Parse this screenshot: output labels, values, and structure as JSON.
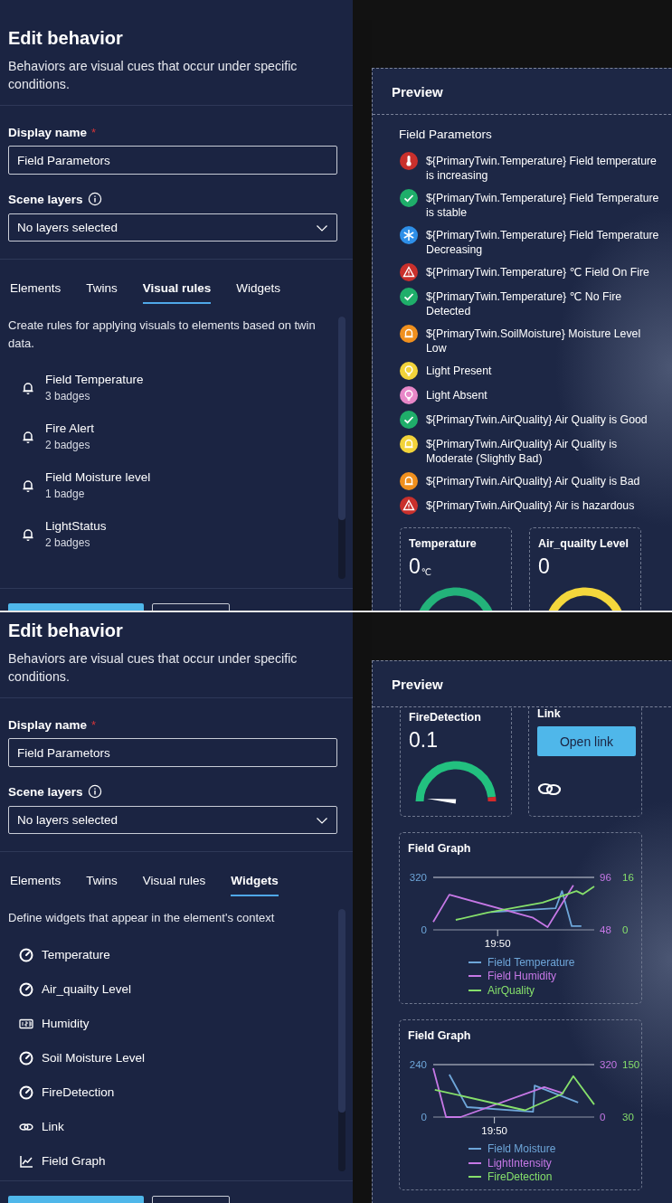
{
  "screens": [
    {
      "editor": {
        "title": "Edit behavior",
        "description": "Behaviors are visual cues that occur under specific conditions.",
        "display_name": {
          "label": "Display name",
          "required_mark": "*",
          "value": "Field Parametors"
        },
        "scene_layers": {
          "label": "Scene layers",
          "value": "No layers selected"
        },
        "tabs": [
          {
            "label": "Elements",
            "selected": false
          },
          {
            "label": "Twins",
            "selected": false
          },
          {
            "label": "Visual rules",
            "selected": true
          },
          {
            "label": "Widgets",
            "selected": false
          }
        ],
        "tab_description": "Create rules for applying visuals to elements based on twin data.",
        "items": [
          {
            "kind": "rule",
            "name": "Field Temperature",
            "detail": "3 badges"
          },
          {
            "kind": "rule",
            "name": "Fire Alert",
            "detail": "2 badges"
          },
          {
            "kind": "rule",
            "name": "Field Moisture level",
            "detail": "1 badge"
          },
          {
            "kind": "rule",
            "name": "LightStatus",
            "detail": "2 badges"
          }
        ],
        "footer_buttons": [
          {
            "kind": "primary"
          },
          {
            "kind": "secondary"
          }
        ]
      },
      "preview": {
        "title": "Preview",
        "scrolled": false,
        "group_title": "Field Parametors",
        "badges": [
          {
            "kind": "thermometer",
            "color": "#c9302c",
            "text": "${PrimaryTwin.Temperature} Field temperature is increasing"
          },
          {
            "kind": "check",
            "color": "#1fae6a",
            "text": "${PrimaryTwin.Temperature} Field Temperature is stable"
          },
          {
            "kind": "snowflake",
            "color": "#2e8fe8",
            "text": "${PrimaryTwin.Temperature} Field Temperature Decreasing"
          },
          {
            "kind": "warning",
            "color": "#c9302c",
            "text": "${PrimaryTwin.Temperature} ℃ Field On Fire"
          },
          {
            "kind": "check",
            "color": "#1fae6a",
            "text": "${PrimaryTwin.Temperature} ℃ No Fire Detected"
          },
          {
            "kind": "bell",
            "color": "#f0901e",
            "text": "${PrimaryTwin.SoilMoisture} Moisture Level Low"
          },
          {
            "kind": "bulb",
            "color": "#f2d33a",
            "text": "Light Present"
          },
          {
            "kind": "bulb",
            "color": "#e887c8",
            "text": "Light Absent"
          },
          {
            "kind": "check",
            "color": "#1fae6a",
            "text": "${PrimaryTwin.AirQuality} Air Quality is Good"
          },
          {
            "kind": "bell",
            "color": "#f2d33a",
            "text": "${PrimaryTwin.AirQuality} Air Quality is Moderate (Slightly Bad)"
          },
          {
            "kind": "bell",
            "color": "#f0901e",
            "text": "${PrimaryTwin.AirQuality} Air Quality is Bad"
          },
          {
            "kind": "warning",
            "color": "#c9302c",
            "text": "${PrimaryTwin.AirQuality} Air is hazardous"
          }
        ],
        "widgets": [
          {
            "kind": "gauge",
            "title": "Temperature",
            "value": "0",
            "unit": "℃",
            "color": "#23b27a"
          },
          {
            "kind": "gauge",
            "title": "Air_quailty Level",
            "value": "0",
            "color": "#f4d73c"
          }
        ]
      }
    },
    {
      "editor": {
        "title": "Edit behavior",
        "description": "Behaviors are visual cues that occur under specific conditions.",
        "display_name": {
          "label": "Display name",
          "required_mark": "*",
          "value": "Field Parametors"
        },
        "scene_layers": {
          "label": "Scene layers",
          "value": "No layers selected"
        },
        "tabs": [
          {
            "label": "Elements",
            "selected": false
          },
          {
            "label": "Twins",
            "selected": false
          },
          {
            "label": "Visual rules",
            "selected": false
          },
          {
            "label": "Widgets",
            "selected": true
          }
        ],
        "tab_description": "Define widgets that appear in the element's context",
        "items": [
          {
            "kind": "gauge",
            "name": "Temperature"
          },
          {
            "kind": "gauge",
            "name": "Air_quailty Level"
          },
          {
            "kind": "number",
            "name": "Humidity"
          },
          {
            "kind": "gauge",
            "name": "Soil Moisture Level"
          },
          {
            "kind": "gauge",
            "name": "FireDetection"
          },
          {
            "kind": "link",
            "name": "Link"
          },
          {
            "kind": "graph",
            "name": "Field Graph"
          }
        ],
        "footer_buttons": [
          {
            "kind": "primary"
          },
          {
            "kind": "secondary"
          }
        ]
      },
      "preview": {
        "title": "Preview",
        "scrolled": true,
        "widgets": [
          {
            "kind": "gauge",
            "title": "FireDetection",
            "value": "0.1",
            "color": "#22c07f"
          },
          {
            "kind": "link",
            "title": "Link",
            "button": "Open link"
          },
          {
            "kind": "graph",
            "title": "Field Graph",
            "axis_labels": [
              [
                "320",
                "0"
              ],
              [
                "96",
                "48"
              ],
              [
                "16",
                "0"
              ]
            ],
            "time_label": "19:50",
            "legend": [
              {
                "name": "Field Temperature",
                "color": "#6ea6d9"
              },
              {
                "name": "Field Humidity",
                "color": "#c678e6"
              },
              {
                "name": "AirQuality",
                "color": "#86e06b"
              }
            ]
          },
          {
            "kind": "graph",
            "title": "Field Graph",
            "axis_labels": [
              [
                "240",
                "0"
              ],
              [
                "320",
                "0"
              ],
              [
                "150",
                "30"
              ]
            ],
            "time_label": "19:50",
            "legend": [
              {
                "name": "Field Moisture",
                "color": "#6ea6d9"
              },
              {
                "name": "LightIntensity",
                "color": "#c678e6"
              },
              {
                "name": "FireDetection",
                "color": "#86e06b"
              }
            ]
          }
        ]
      }
    }
  ]
}
